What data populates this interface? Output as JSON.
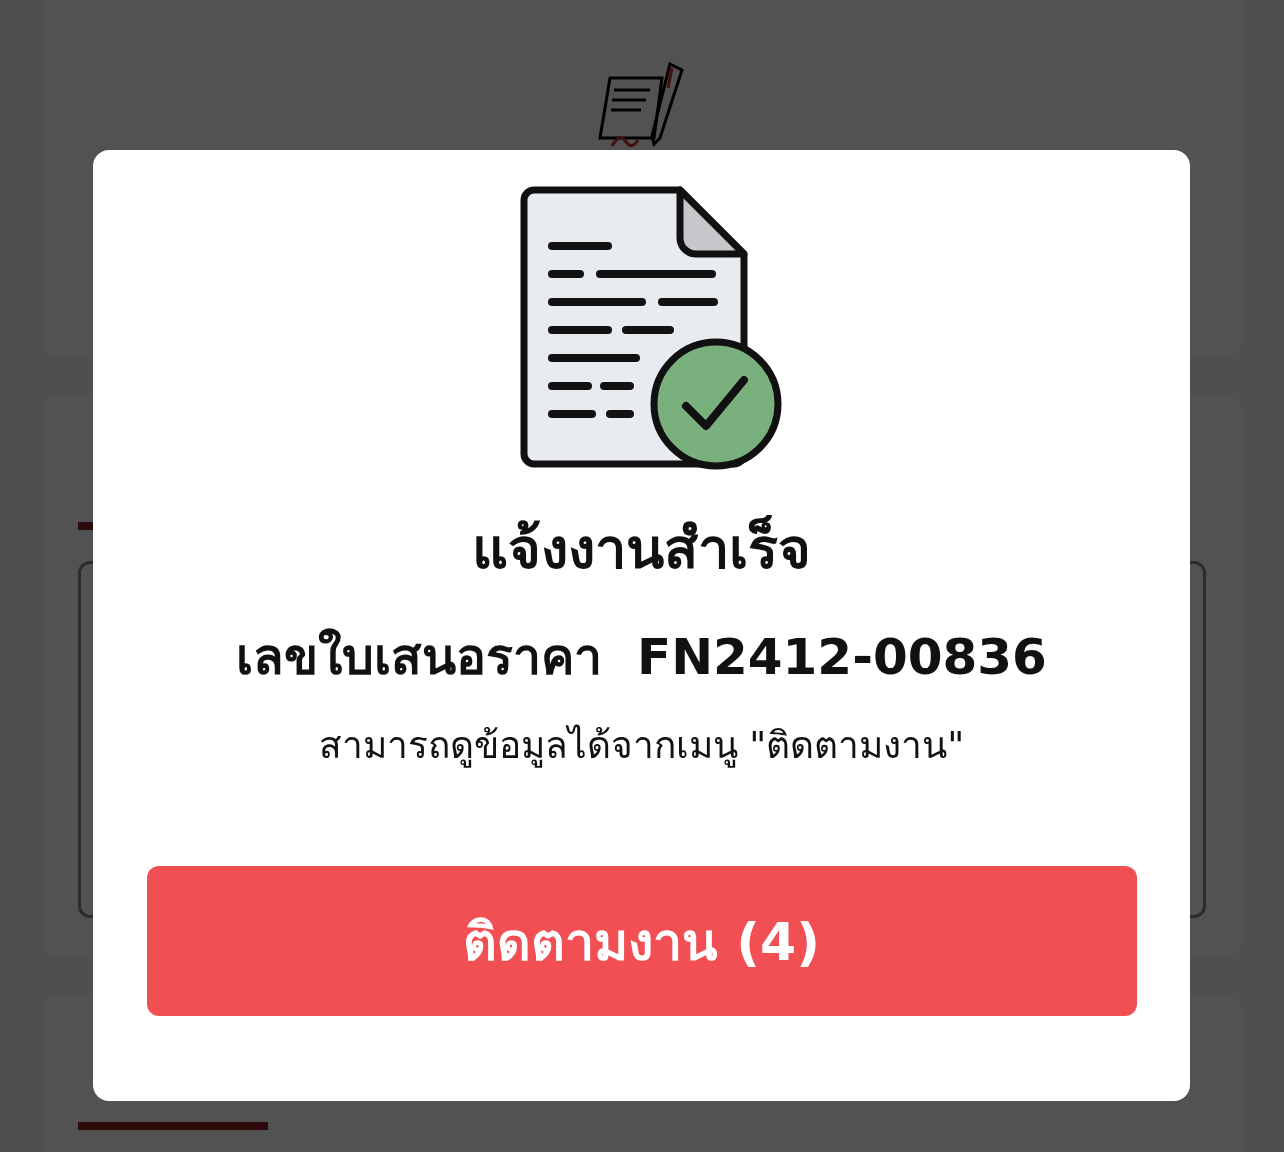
{
  "dialog": {
    "title": "แจ้งงานสำเร็จ",
    "quote_line": "เลขใบเสนอราคา  FN2412-00836",
    "message": "สามารถดูข้อมูลได้จากเมนู \"ติดตามงาน\"",
    "button": "ติดตามงาน (4)"
  }
}
